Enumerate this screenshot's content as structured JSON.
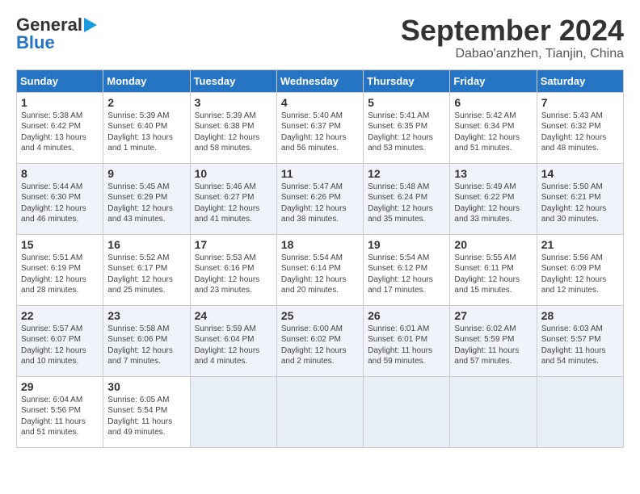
{
  "logo": {
    "line1": "General",
    "line2": "Blue"
  },
  "title": "September 2024",
  "location": "Dabao'anzhen, Tianjin, China",
  "days_of_week": [
    "Sunday",
    "Monday",
    "Tuesday",
    "Wednesday",
    "Thursday",
    "Friday",
    "Saturday"
  ],
  "weeks": [
    [
      {
        "day": "1",
        "sunrise": "5:38 AM",
        "sunset": "6:42 PM",
        "daylight": "13 hours and 4 minutes."
      },
      {
        "day": "2",
        "sunrise": "5:39 AM",
        "sunset": "6:40 PM",
        "daylight": "13 hours and 1 minute."
      },
      {
        "day": "3",
        "sunrise": "5:39 AM",
        "sunset": "6:38 PM",
        "daylight": "12 hours and 58 minutes."
      },
      {
        "day": "4",
        "sunrise": "5:40 AM",
        "sunset": "6:37 PM",
        "daylight": "12 hours and 56 minutes."
      },
      {
        "day": "5",
        "sunrise": "5:41 AM",
        "sunset": "6:35 PM",
        "daylight": "12 hours and 53 minutes."
      },
      {
        "day": "6",
        "sunrise": "5:42 AM",
        "sunset": "6:34 PM",
        "daylight": "12 hours and 51 minutes."
      },
      {
        "day": "7",
        "sunrise": "5:43 AM",
        "sunset": "6:32 PM",
        "daylight": "12 hours and 48 minutes."
      }
    ],
    [
      {
        "day": "8",
        "sunrise": "5:44 AM",
        "sunset": "6:30 PM",
        "daylight": "12 hours and 46 minutes."
      },
      {
        "day": "9",
        "sunrise": "5:45 AM",
        "sunset": "6:29 PM",
        "daylight": "12 hours and 43 minutes."
      },
      {
        "day": "10",
        "sunrise": "5:46 AM",
        "sunset": "6:27 PM",
        "daylight": "12 hours and 41 minutes."
      },
      {
        "day": "11",
        "sunrise": "5:47 AM",
        "sunset": "6:26 PM",
        "daylight": "12 hours and 38 minutes."
      },
      {
        "day": "12",
        "sunrise": "5:48 AM",
        "sunset": "6:24 PM",
        "daylight": "12 hours and 35 minutes."
      },
      {
        "day": "13",
        "sunrise": "5:49 AM",
        "sunset": "6:22 PM",
        "daylight": "12 hours and 33 minutes."
      },
      {
        "day": "14",
        "sunrise": "5:50 AM",
        "sunset": "6:21 PM",
        "daylight": "12 hours and 30 minutes."
      }
    ],
    [
      {
        "day": "15",
        "sunrise": "5:51 AM",
        "sunset": "6:19 PM",
        "daylight": "12 hours and 28 minutes."
      },
      {
        "day": "16",
        "sunrise": "5:52 AM",
        "sunset": "6:17 PM",
        "daylight": "12 hours and 25 minutes."
      },
      {
        "day": "17",
        "sunrise": "5:53 AM",
        "sunset": "6:16 PM",
        "daylight": "12 hours and 23 minutes."
      },
      {
        "day": "18",
        "sunrise": "5:54 AM",
        "sunset": "6:14 PM",
        "daylight": "12 hours and 20 minutes."
      },
      {
        "day": "19",
        "sunrise": "5:54 AM",
        "sunset": "6:12 PM",
        "daylight": "12 hours and 17 minutes."
      },
      {
        "day": "20",
        "sunrise": "5:55 AM",
        "sunset": "6:11 PM",
        "daylight": "12 hours and 15 minutes."
      },
      {
        "day": "21",
        "sunrise": "5:56 AM",
        "sunset": "6:09 PM",
        "daylight": "12 hours and 12 minutes."
      }
    ],
    [
      {
        "day": "22",
        "sunrise": "5:57 AM",
        "sunset": "6:07 PM",
        "daylight": "12 hours and 10 minutes."
      },
      {
        "day": "23",
        "sunrise": "5:58 AM",
        "sunset": "6:06 PM",
        "daylight": "12 hours and 7 minutes."
      },
      {
        "day": "24",
        "sunrise": "5:59 AM",
        "sunset": "6:04 PM",
        "daylight": "12 hours and 4 minutes."
      },
      {
        "day": "25",
        "sunrise": "6:00 AM",
        "sunset": "6:02 PM",
        "daylight": "12 hours and 2 minutes."
      },
      {
        "day": "26",
        "sunrise": "6:01 AM",
        "sunset": "6:01 PM",
        "daylight": "11 hours and 59 minutes."
      },
      {
        "day": "27",
        "sunrise": "6:02 AM",
        "sunset": "5:59 PM",
        "daylight": "11 hours and 57 minutes."
      },
      {
        "day": "28",
        "sunrise": "6:03 AM",
        "sunset": "5:57 PM",
        "daylight": "11 hours and 54 minutes."
      }
    ],
    [
      {
        "day": "29",
        "sunrise": "6:04 AM",
        "sunset": "5:56 PM",
        "daylight": "11 hours and 51 minutes."
      },
      {
        "day": "30",
        "sunrise": "6:05 AM",
        "sunset": "5:54 PM",
        "daylight": "11 hours and 49 minutes."
      },
      null,
      null,
      null,
      null,
      null
    ]
  ]
}
